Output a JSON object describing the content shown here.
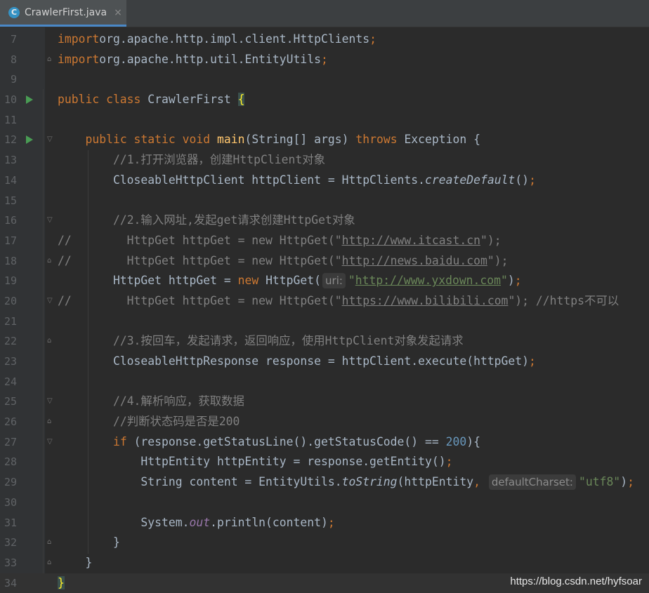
{
  "tab": {
    "icon": "C",
    "label": "CrawlerFirst.java",
    "close": "×"
  },
  "lines": [
    {
      "n": "7",
      "parts": [
        [
          "kw",
          "import"
        ],
        [
          "",
          "org.apache.http.impl.client.HttpClients"
        ],
        [
          "kw",
          ";"
        ]
      ]
    },
    {
      "n": "8",
      "parts": [
        [
          "kw",
          "import"
        ],
        [
          "",
          "org.apache.http.util.EntityUtils"
        ],
        [
          "kw",
          ";"
        ]
      ]
    },
    {
      "n": "9",
      "parts": []
    },
    {
      "n": "10",
      "parts": [
        [
          "kw",
          "public class "
        ],
        [
          "",
          "CrawlerFirst "
        ],
        [
          "brace",
          "{"
        ]
      ]
    },
    {
      "n": "11",
      "parts": []
    },
    {
      "n": "12",
      "parts": [
        [
          "",
          "    "
        ],
        [
          "kw",
          "public static void "
        ],
        [
          "fn",
          "main"
        ],
        [
          "",
          "(String[] args) "
        ],
        [
          "kw",
          "throws "
        ],
        [
          "",
          "Exception {"
        ]
      ]
    },
    {
      "n": "13",
      "parts": [
        [
          "",
          "        "
        ],
        [
          "cm",
          "//1.打开浏览器，创建HttpClient对象"
        ]
      ]
    },
    {
      "n": "14",
      "parts": [
        [
          "",
          "        CloseableHttpClient httpClient = HttpClients."
        ],
        [
          "ital",
          "createDefault"
        ],
        [
          "",
          "()"
        ],
        [
          "kw",
          ";"
        ]
      ]
    },
    {
      "n": "15",
      "parts": []
    },
    {
      "n": "16",
      "parts": [
        [
          "",
          "        "
        ],
        [
          "cm",
          "//2.输入网址,发起get请求创建HttpGet对象"
        ]
      ]
    },
    {
      "n": "17",
      "parts": [
        [
          "cm",
          "//        HttpGet httpGet = new HttpGet(\""
        ],
        [
          "cmurl",
          "http://www.itcast.cn"
        ],
        [
          "cm",
          "\");"
        ]
      ]
    },
    {
      "n": "18",
      "parts": [
        [
          "cm",
          "//        HttpGet httpGet = new HttpGet(\""
        ],
        [
          "cmurl",
          "http://news.baidu.com"
        ],
        [
          "cm",
          "\");"
        ]
      ]
    },
    {
      "n": "19",
      "parts": [
        [
          "",
          "        HttpGet httpGet = "
        ],
        [
          "kw",
          "new "
        ],
        [
          "",
          "HttpGet("
        ],
        [
          "hint",
          "uri:"
        ],
        [
          "str",
          "\""
        ],
        [
          "url",
          "http://www.yxdown.com"
        ],
        [
          "str",
          "\""
        ],
        [
          "",
          ")"
        ],
        [
          "kw",
          ";"
        ]
      ]
    },
    {
      "n": "20",
      "parts": [
        [
          "cm",
          "//        HttpGet httpGet = new HttpGet(\""
        ],
        [
          "cmurl",
          "https://www.bilibili.com"
        ],
        [
          "cm",
          "\"); //https不可以"
        ]
      ]
    },
    {
      "n": "21",
      "parts": []
    },
    {
      "n": "22",
      "parts": [
        [
          "",
          "        "
        ],
        [
          "cm",
          "//3.按回车，发起请求，返回响应，使用HttpClient对象发起请求"
        ]
      ]
    },
    {
      "n": "23",
      "parts": [
        [
          "",
          "        CloseableHttpResponse response = httpClient.execute(httpGet)"
        ],
        [
          "kw",
          ";"
        ]
      ]
    },
    {
      "n": "24",
      "parts": []
    },
    {
      "n": "25",
      "parts": [
        [
          "",
          "        "
        ],
        [
          "cm",
          "//4.解析响应，获取数据"
        ]
      ]
    },
    {
      "n": "26",
      "parts": [
        [
          "",
          "        "
        ],
        [
          "cm",
          "//判断状态码是否是200"
        ]
      ]
    },
    {
      "n": "27",
      "parts": [
        [
          "",
          "        "
        ],
        [
          "kw",
          "if "
        ],
        [
          "",
          "(response.getStatusLine().getStatusCode() == "
        ],
        [
          "num",
          "200"
        ],
        [
          "",
          "){"
        ]
      ]
    },
    {
      "n": "28",
      "parts": [
        [
          "",
          "            HttpEntity httpEntity = response.getEntity()"
        ],
        [
          "kw",
          ";"
        ]
      ]
    },
    {
      "n": "29",
      "parts": [
        [
          "",
          "            String content = EntityUtils."
        ],
        [
          "ital",
          "toString"
        ],
        [
          "",
          "(httpEntity"
        ],
        [
          "kw",
          ", "
        ],
        [
          "hint",
          "defaultCharset:"
        ],
        [
          "str",
          "\"utf8\""
        ],
        [
          "",
          ")"
        ],
        [
          "kw",
          ";"
        ]
      ]
    },
    {
      "n": "30",
      "parts": []
    },
    {
      "n": "31",
      "parts": [
        [
          "",
          "            System."
        ],
        [
          "static",
          "out"
        ],
        [
          "",
          ".println(content)"
        ],
        [
          "kw",
          ";"
        ]
      ]
    },
    {
      "n": "32",
      "parts": [
        [
          "",
          "        }"
        ]
      ]
    },
    {
      "n": "33",
      "parts": [
        [
          "",
          "    }"
        ]
      ]
    },
    {
      "n": "34",
      "parts": [
        [
          "brace",
          "}"
        ]
      ]
    }
  ],
  "run_lines": [
    "10",
    "12"
  ],
  "fold_lines": {
    "8": "⌂",
    "12": "▽",
    "16": "▽",
    "18": "⌂",
    "20": "▽",
    "22": "⌂",
    "25": "▽",
    "26": "⌂",
    "27": "▽",
    "32": "⌂",
    "33": "⌂"
  },
  "watermark": "https://blog.csdn.net/hyfsoar",
  "colors": {
    "background": "#2b2b2b",
    "keyword": "#cc7832",
    "comment": "#808080",
    "string": "#6a8759",
    "number": "#6897bb",
    "function": "#ffc66d"
  }
}
